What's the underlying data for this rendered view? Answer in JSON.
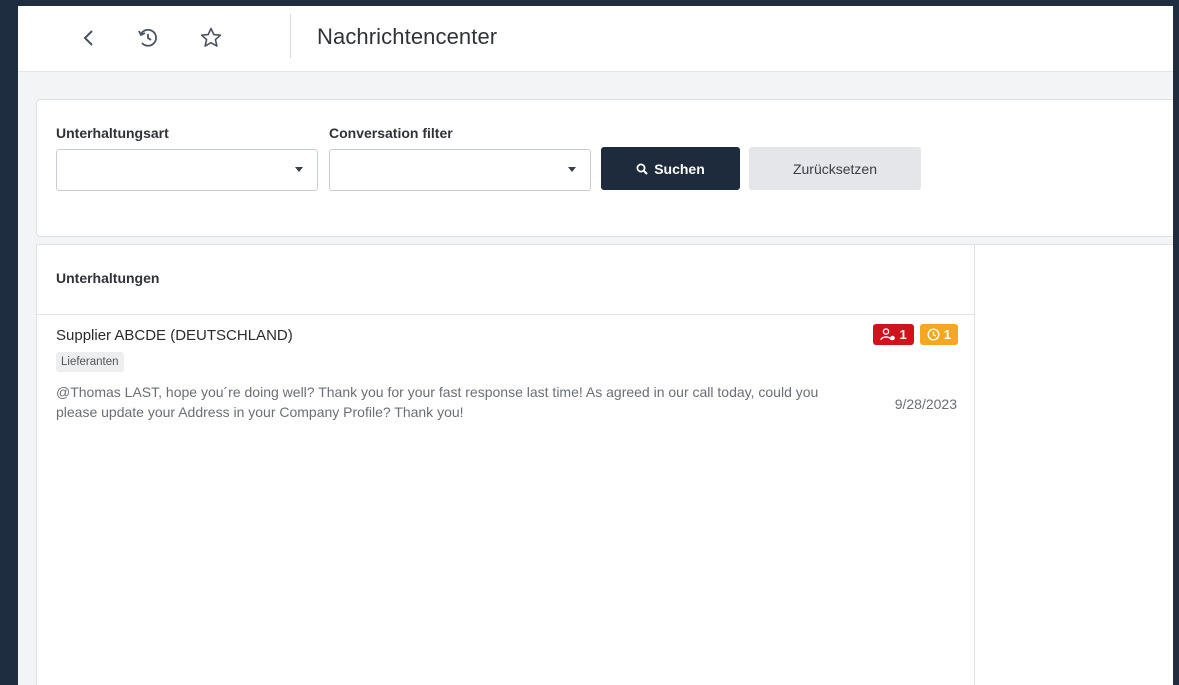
{
  "header": {
    "title": "Nachrichtencenter",
    "icons": [
      "back-icon",
      "history-icon",
      "star-icon"
    ]
  },
  "filters": {
    "conversation_type": {
      "label": "Unterhaltungsart",
      "value": ""
    },
    "conversation_filter": {
      "label": "Conversation filter",
      "value": ""
    },
    "search_label": "Suchen",
    "reset_label": "Zurücksetzen"
  },
  "list": {
    "title": "Unterhaltungen",
    "items": [
      {
        "name": "Supplier ABCDE (DEUTSCHLAND)",
        "tag": "Lieferanten",
        "message": "@Thomas LAST, hope you´re doing well? Thank you for your fast response last time! As agreed in our call today, could you please update your Address in your Company Profile? Thank you!",
        "date": "9/28/2023",
        "badge_users": "1",
        "badge_pending": "1"
      }
    ]
  },
  "colors": {
    "badge_red": "#d0121b",
    "badge_orange": "#f5a623",
    "primary_button": "#1e2b3c"
  }
}
